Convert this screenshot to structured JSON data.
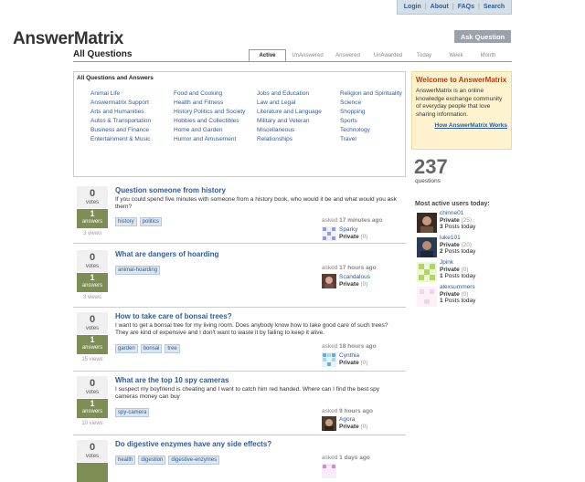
{
  "topnav": {
    "login": "Login",
    "about": "About",
    "faqs": "FAQs",
    "search": "Search"
  },
  "logo": "AnswerMatrix",
  "ask_button": "Ask Question",
  "heading": "All Questions",
  "tabs": [
    "Active",
    "UnAnswered",
    "Answered",
    "UnAwarded",
    "Today",
    "Week",
    "Month"
  ],
  "categories": {
    "title": "All Questions and Answers",
    "col1": [
      "Animal Life",
      "Answermatrix Support",
      "Arts and Humanities",
      "Autos & Transportation",
      "Business and Finance",
      "Entertainment & Music"
    ],
    "col2": [
      "Food and Cooking",
      "Health and Fitness",
      "History Politics and Society",
      "Hobbies and Collectibles",
      "Home and Garden",
      "Humor and Amusement"
    ],
    "col3": [
      "Jobs and Education",
      "Law and Legal",
      "Literature and Language",
      "Military and Veteran",
      "Miscellaneous",
      "Relationships"
    ],
    "col4": [
      "Religion and Spirituality",
      "Science",
      "Shopping",
      "Sports",
      "Technology",
      "Travel"
    ]
  },
  "welcome": {
    "title": "Welcome to AnswerMatrix",
    "text": "AnswerMatrix is an online knowledge exchange community of everyday people that love sharing information.",
    "link": "How AnswerMatrix Works"
  },
  "count": "237",
  "count_label": "questions",
  "active_title": "Most active users today:",
  "users": [
    {
      "name": "chinne01",
      "status": "Private",
      "score": "(25)",
      "posts": "3",
      "posts_label": "Posts today"
    },
    {
      "name": "luke101",
      "status": "Private",
      "score": "(20)",
      "posts": "2",
      "posts_label": "Posts today"
    },
    {
      "name": "Jpink",
      "status": "Private",
      "score": "(0)",
      "posts": "1",
      "posts_label": "Posts today"
    },
    {
      "name": "alexsummers",
      "status": "Private",
      "score": "(0)",
      "posts": "1",
      "posts_label": "Posts today"
    }
  ],
  "labels": {
    "votes": "votes",
    "answers": "answers",
    "asked": "asked"
  },
  "questions": [
    {
      "votes": "0",
      "answers": "1",
      "views": "3 views",
      "title": "Question someone from history",
      "excerpt": "If you could spend five minutes with someone from a history book, who would it be and what would you ask them?",
      "tags": [
        "history",
        "politics"
      ],
      "when": "17 minutes ago",
      "user": "Sparky",
      "status": "Private",
      "score": "(0)"
    },
    {
      "votes": "0",
      "answers": "1",
      "views": "3 views",
      "title": "What are dangers of hoarding",
      "excerpt": "",
      "tags": [
        "animal-hoarding"
      ],
      "when": "17 hours ago",
      "user": "Scandalous",
      "status": "Private",
      "score": "(0)"
    },
    {
      "votes": "0",
      "answers": "1",
      "views": "15 views",
      "title": "How to take care of bonsai trees?",
      "excerpt": "I want to get a bonsai tree for my living room. Does anybody know how to take good care of such trees? They are kind of expensive and I don't want to waste it by failing to keep it alive.",
      "tags": [
        "garden",
        "bonsai",
        "tree"
      ],
      "when": "18 hours ago",
      "user": "Cynthia",
      "status": "Private",
      "score": "(0)"
    },
    {
      "votes": "0",
      "answers": "1",
      "views": "10 views",
      "title": "What are the top 10 spy cameras",
      "excerpt": "I suspect my boyfriend is cheating and I want to catch him red handed. Where can I find the best spy cameras money can buy",
      "tags": [
        "spy-camera"
      ],
      "when": "9 hours ago",
      "user": "Agora",
      "status": "Private",
      "score": "(0)"
    },
    {
      "votes": "0",
      "answers": "",
      "views": "",
      "title": "Do digestive enzymes have any side effects?",
      "excerpt": "",
      "tags": [
        "health",
        "digestion",
        "digestive-enzymes"
      ],
      "when": "1 days ago",
      "user": "",
      "status": "",
      "score": ""
    }
  ]
}
